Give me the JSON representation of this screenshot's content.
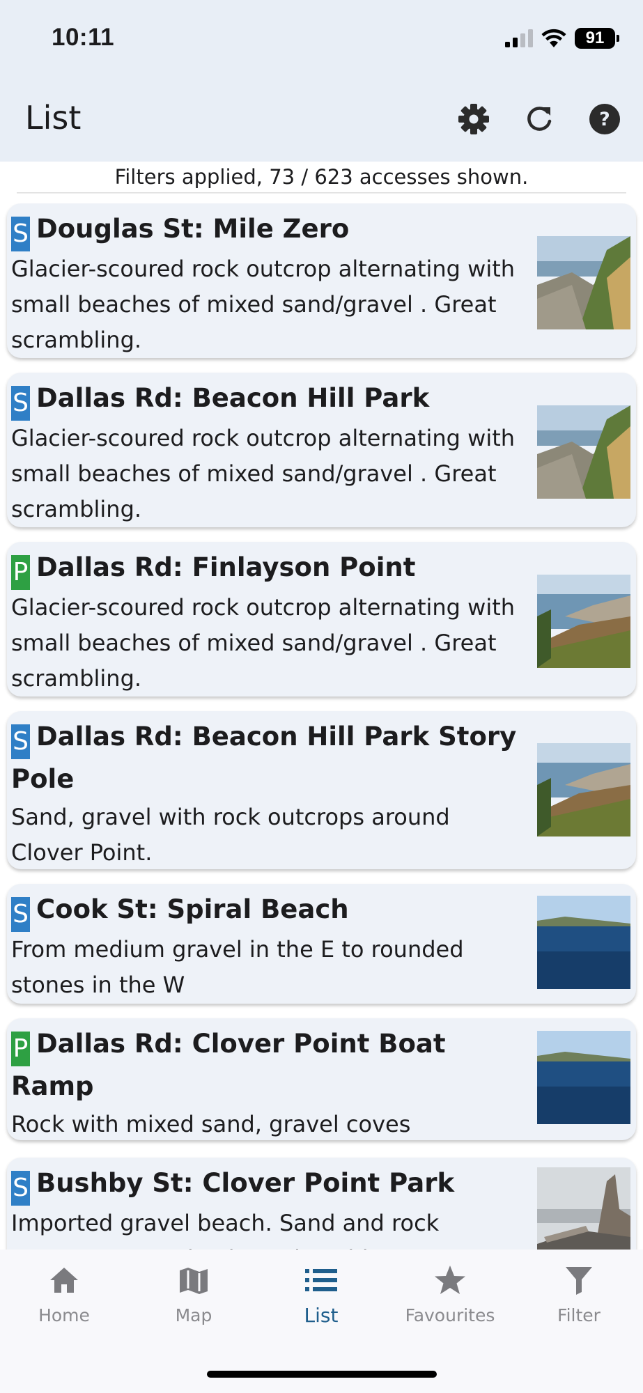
{
  "status_bar": {
    "time": "10:11",
    "battery": "91"
  },
  "app_bar": {
    "title": "List",
    "actions": [
      "gear-icon",
      "refresh-icon",
      "help-icon"
    ]
  },
  "filter_banner": "Filters applied, 73 / 623 accesses shown.",
  "colors": {
    "badge_s": "#2f7fc6",
    "badge_p": "#2ea043",
    "accent": "#1f5e8c",
    "header_bg": "#e8eef6",
    "card_bg": "#eef2f8"
  },
  "items": [
    {
      "badge": "S",
      "title": "Douglas St: Mile Zero",
      "description": "Glacier-scoured rock outcrop alternating with small beaches of mixed sand/gravel . Great scrambling."
    },
    {
      "badge": "S",
      "title": "Dallas Rd: Beacon Hill Park",
      "description": "Glacier-scoured rock outcrop alternating with small beaches of mixed sand/gravel . Great scrambling."
    },
    {
      "badge": "P",
      "title": "Dallas Rd: Finlayson Point",
      "description": "Glacier-scoured rock outcrop alternating with small beaches of mixed sand/gravel . Great scrambling."
    },
    {
      "badge": "S",
      "title": "Dallas Rd: Beacon Hill Park Story Pole",
      "description": "Sand, gravel with rock outcrops around Clover Point."
    },
    {
      "badge": "S",
      "title": "Cook St: Spiral Beach",
      "description": "From medium gravel in the E to rounded stones in the W"
    },
    {
      "badge": "P",
      "title": "Dallas Rd: Clover Point Boat Ramp",
      "description": "Rock with mixed sand, gravel coves"
    },
    {
      "badge": "S",
      "title": "Bushby St: Clover Point Park",
      "description": "Imported gravel beach. Sand and rock outcrops around point at low tide."
    }
  ],
  "bottom_nav": [
    {
      "label": "Home",
      "icon": "home-icon",
      "active": false
    },
    {
      "label": "Map",
      "icon": "map-icon",
      "active": false
    },
    {
      "label": "List",
      "icon": "list-icon",
      "active": true
    },
    {
      "label": "Favourites",
      "icon": "star-icon",
      "active": false
    },
    {
      "label": "Filter",
      "icon": "filter-icon",
      "active": false
    }
  ]
}
